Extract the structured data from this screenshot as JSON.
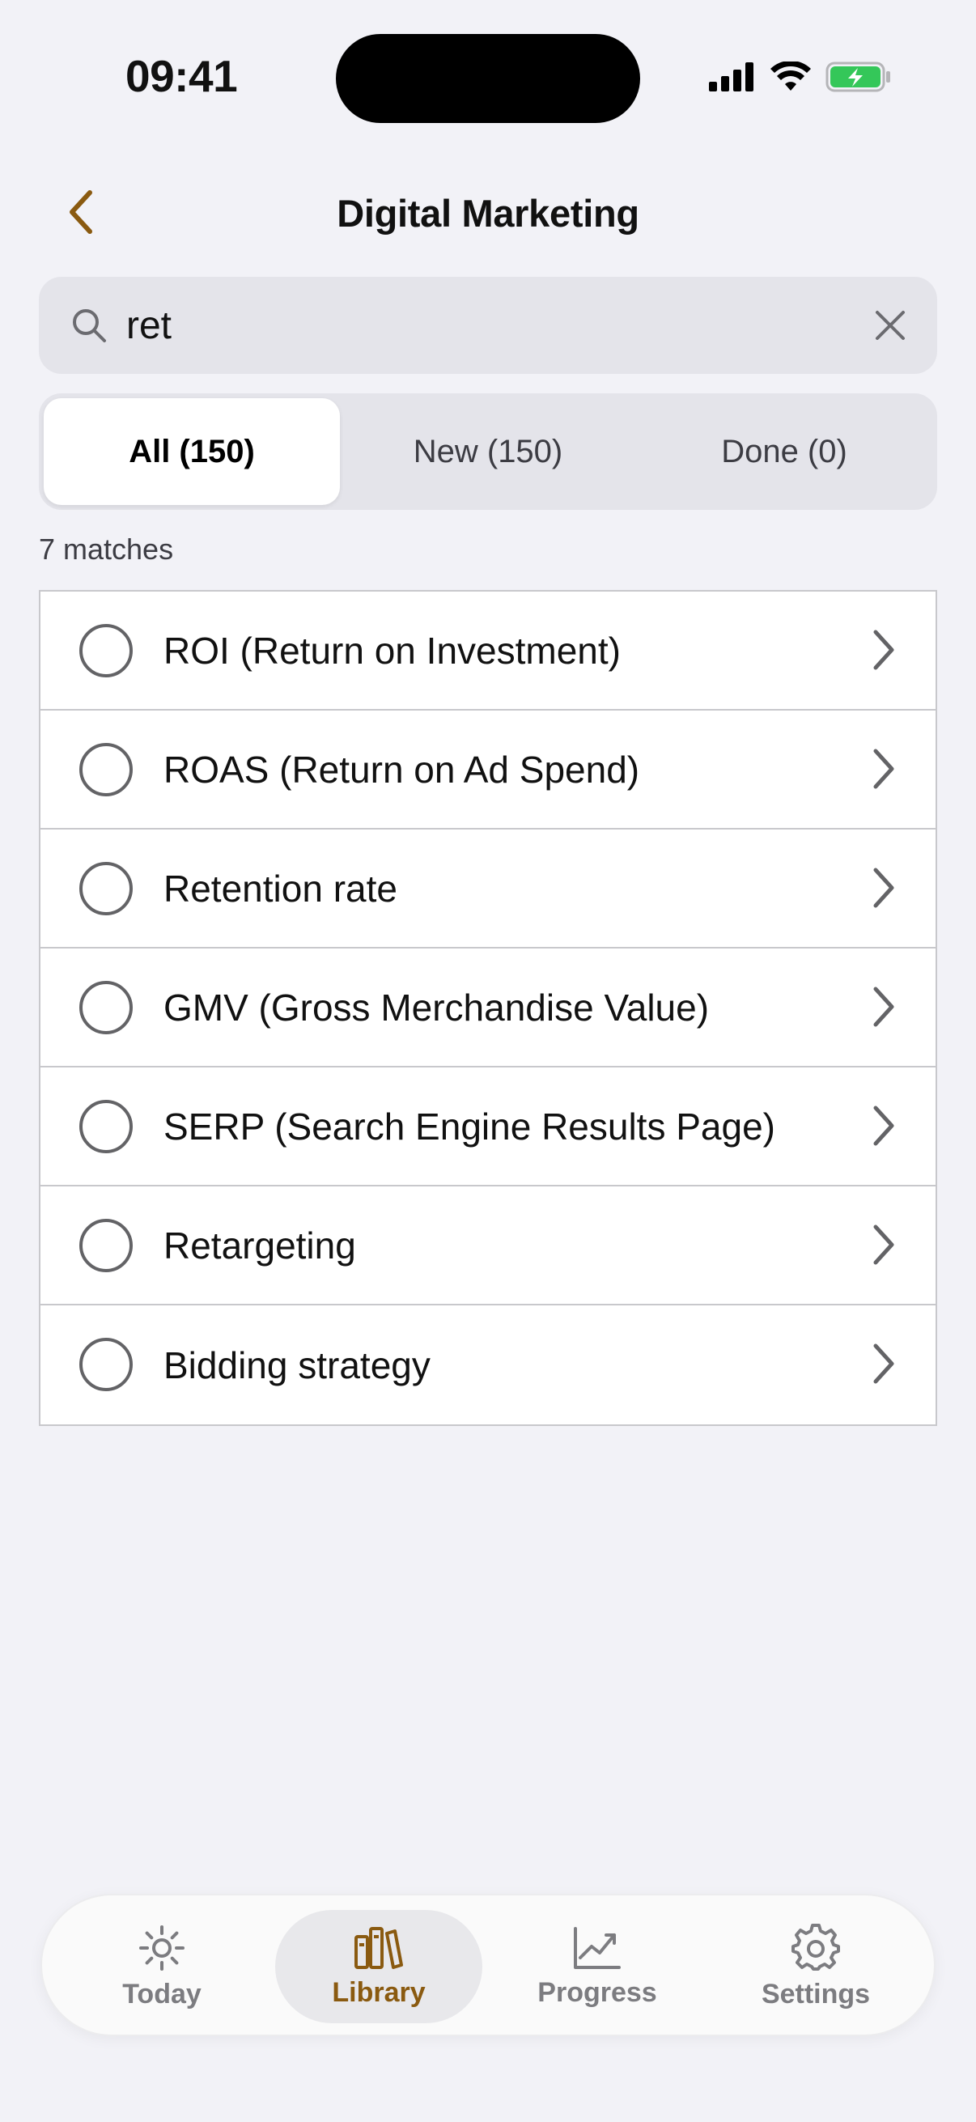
{
  "status_bar": {
    "time": "09:41"
  },
  "nav": {
    "title": "Digital Marketing"
  },
  "search": {
    "value": "ret",
    "placeholder": "Search"
  },
  "segments": [
    {
      "label": "All (150)",
      "active": true
    },
    {
      "label": "New (150)",
      "active": false
    },
    {
      "label": "Done (0)",
      "active": false
    }
  ],
  "results": {
    "count_label": "7 matches",
    "items": [
      {
        "label": "ROI (Return on Investment)"
      },
      {
        "label": "ROAS (Return on Ad Spend)"
      },
      {
        "label": "Retention rate"
      },
      {
        "label": "GMV (Gross Merchandise Value)"
      },
      {
        "label": "SERP (Search Engine Results Page)"
      },
      {
        "label": "Retargeting"
      },
      {
        "label": "Bidding strategy"
      }
    ]
  },
  "tabbar": {
    "tabs": [
      {
        "label": "Today",
        "icon": "sun-icon",
        "active": false
      },
      {
        "label": "Library",
        "icon": "books-icon",
        "active": true
      },
      {
        "label": "Progress",
        "icon": "chart-icon",
        "active": false
      },
      {
        "label": "Settings",
        "icon": "gear-icon",
        "active": false
      }
    ]
  },
  "colors": {
    "accent": "#8a5a10",
    "background": "#f2f2f7",
    "battery": "#34c759"
  }
}
